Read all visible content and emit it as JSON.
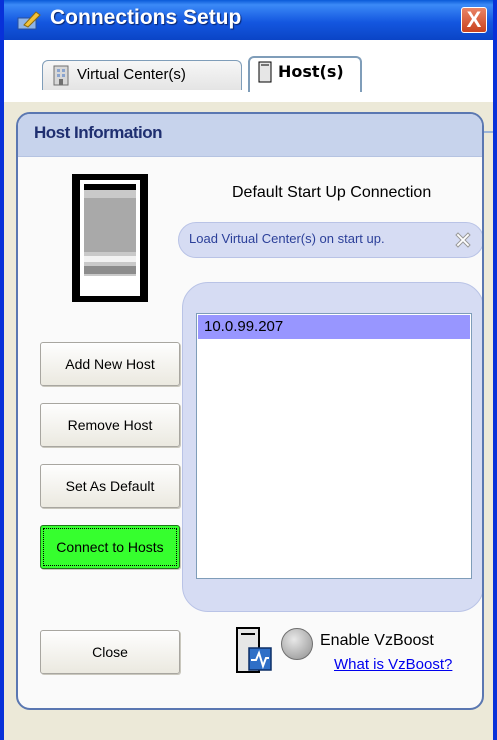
{
  "window": {
    "title": "Connections Setup",
    "close_label": "X"
  },
  "tabs": [
    {
      "label": "Virtual Center(s)",
      "icon": "building-icon",
      "active": false
    },
    {
      "label": "Host(s)",
      "icon": "server-icon",
      "active": true
    }
  ],
  "panel": {
    "title": "Host Information",
    "startup_label": "Default Start Up Connection",
    "load_text": "Load Virtual Center(s) on start up."
  },
  "hosts": [
    "10.0.99.207"
  ],
  "buttons": {
    "add": "Add New Host",
    "remove": "Remove Host",
    "set_default": "Set As Default",
    "connect": "Connect to Hosts",
    "close": "Close"
  },
  "vzboost": {
    "label": "Enable VzBoost",
    "link": "What is VzBoost?"
  },
  "colors": {
    "title_bar": "#1457e0",
    "connect_button": "#36ff2e",
    "selection": "#9896ff",
    "panel_header": "#c7d3ec"
  }
}
